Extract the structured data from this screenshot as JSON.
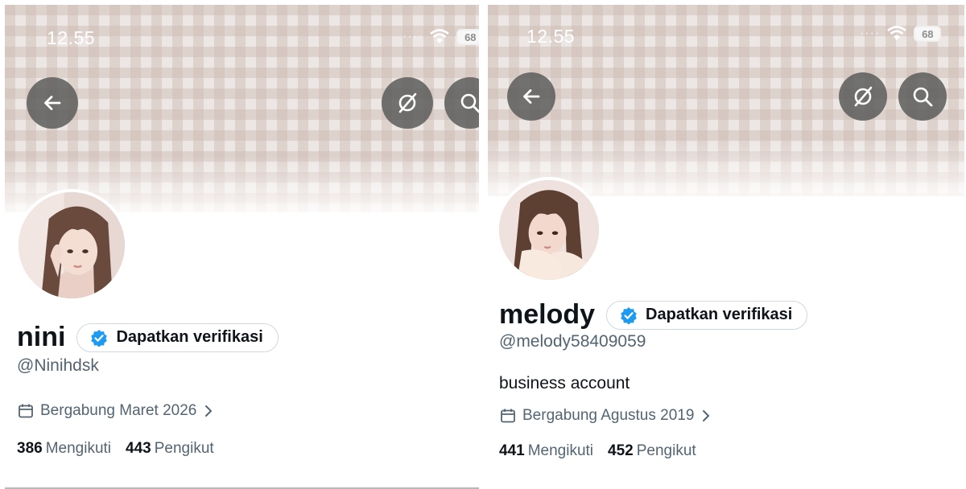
{
  "panels": {
    "left": {
      "status_bar": {
        "time": "12.55",
        "battery": "68"
      },
      "profile": {
        "name": "nini",
        "verify_label": "Dapatkan verifikasi",
        "handle": "@Ninihdsk",
        "joined": "Bergabung Maret 2026",
        "following_count": "386",
        "following_label": "Mengikuti",
        "followers_count": "443",
        "followers_label": "Pengikut"
      }
    },
    "right": {
      "status_bar": {
        "time": "12.55",
        "battery": "68"
      },
      "profile": {
        "name": "melody",
        "verify_label": "Dapatkan verifikasi",
        "handle": "@melody58409059",
        "bio": "business account",
        "joined": "Bergabung Agustus 2019",
        "following_count": "441",
        "following_label": "Mengikuti",
        "followers_count": "452",
        "followers_label": "Pengikut"
      }
    }
  },
  "icons": [
    "back-arrow-icon",
    "grok-icon",
    "search-icon",
    "verified-badge-icon",
    "calendar-icon",
    "chevron-right-icon",
    "wifi-icon"
  ],
  "colors": {
    "verified_blue": "#1d9bf0",
    "secondary_text": "#536471",
    "button_bg": "#5c5c5c"
  }
}
